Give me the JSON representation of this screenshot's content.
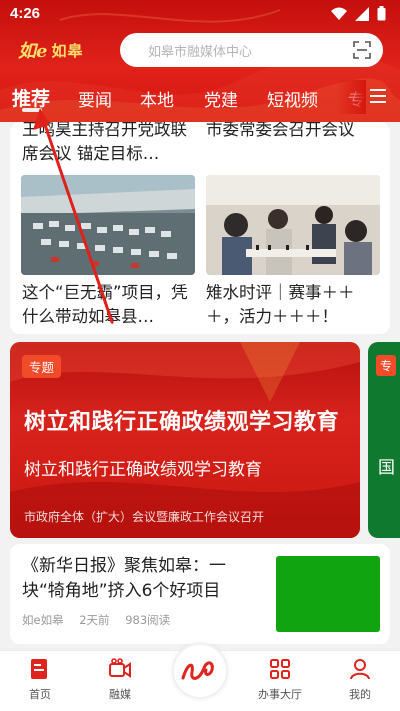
{
  "status_bar": {
    "time": "4:26"
  },
  "header": {
    "logo_script": "如e",
    "logo_text": "如皋",
    "search_placeholder": "如皋市融媒体中心",
    "tabs": [
      {
        "label": "推荐",
        "active": true
      },
      {
        "label": "要闻",
        "active": false
      },
      {
        "label": "本地",
        "active": false
      },
      {
        "label": "党建",
        "active": false
      },
      {
        "label": "短视频",
        "active": false
      },
      {
        "label": "专",
        "active": false
      }
    ]
  },
  "grid": {
    "items": [
      {
        "title": "王鸣昊主持召开党政联席会议 锚定目标…"
      },
      {
        "title": "市委常委会召开会议"
      },
      {
        "title": "这个“巨无霸”项目，凭什么带动如皋县…"
      },
      {
        "title": "雉水时评｜赛事＋＋＋，活力＋＋＋！"
      }
    ]
  },
  "banner": {
    "badge": "专题",
    "headline": "树立和践行正确政绩观学习教育",
    "subheadline": "树立和践行正确政绩观学习教育",
    "caption": "市政府全体（扩大）会议暨廉政工作会议召开",
    "next_badge": "专",
    "next_text": "国"
  },
  "news": {
    "title": "《新华日报》聚焦如皋：一块“犄角地”挤入6个好项目",
    "source": "如e如皋",
    "time": "2天前",
    "reads": "983阅读"
  },
  "bottom_nav": [
    {
      "label": "首页",
      "icon": "home-doc-icon"
    },
    {
      "label": "融媒",
      "icon": "video-camera-icon"
    },
    {
      "label": "办事大厅",
      "icon": "grid-apps-icon"
    },
    {
      "label": "我的",
      "icon": "person-icon"
    }
  ],
  "colors": {
    "brand_red": "#d5160f",
    "accent_yellow": "#ffdf6b",
    "badge_orange": "#f24b2a",
    "thumb_green": "#10a410"
  }
}
